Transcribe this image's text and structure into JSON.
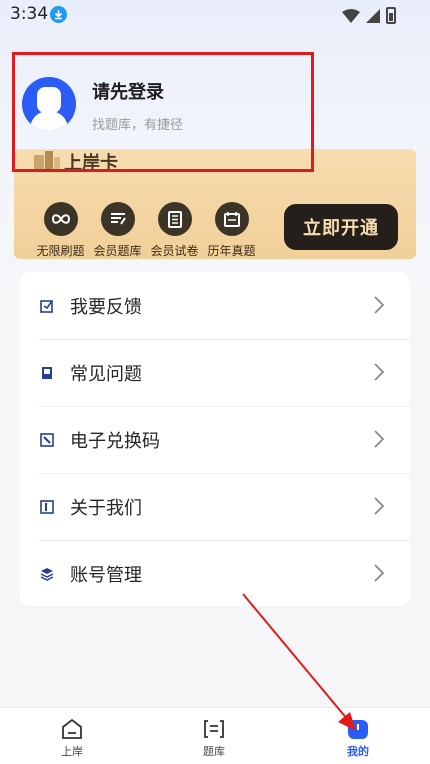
{
  "status_bar": {
    "time": "3:34"
  },
  "login": {
    "title": "请先登录",
    "subtitle": "找题库，有捷径"
  },
  "vip": {
    "title": "上岸卡",
    "features": [
      {
        "label": "无限刷题",
        "icon": "infinity-icon"
      },
      {
        "label": "会员题库",
        "icon": "bank-icon"
      },
      {
        "label": "会员试卷",
        "icon": "paper-icon"
      },
      {
        "label": "历年真题",
        "icon": "calendar-icon"
      }
    ],
    "open_button": "立即开通"
  },
  "menu": {
    "items": [
      {
        "label": "我要反馈",
        "icon": "feedback-icon"
      },
      {
        "label": "常见问题",
        "icon": "faq-icon"
      },
      {
        "label": "电子兑换码",
        "icon": "redeem-icon"
      },
      {
        "label": "关于我们",
        "icon": "about-icon"
      },
      {
        "label": "账号管理",
        "icon": "account-icon"
      }
    ]
  },
  "nav": {
    "items": [
      {
        "label": "上岸",
        "icon": "home-icon"
      },
      {
        "label": "题库",
        "icon": "question-bank-icon"
      },
      {
        "label": "我的",
        "icon": "profile-icon",
        "active": true
      }
    ]
  },
  "colors": {
    "accent": "#2a5cf6",
    "annotation": "#e01b1b",
    "vip_gold": "#f1cf98",
    "vip_dark": "#241f1a"
  }
}
